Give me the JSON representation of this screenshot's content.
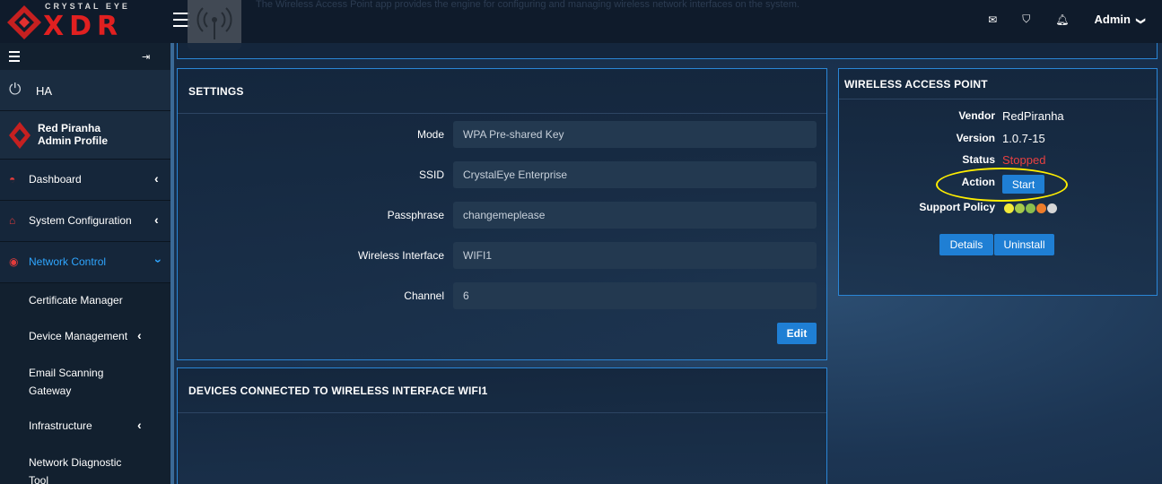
{
  "brand": {
    "top": "CRYSTAL EYE",
    "main": "XDR"
  },
  "app_description": "The Wireless Access Point app provides the engine for configuring and managing wireless network interfaces on the system.",
  "topbar": {
    "mail_icon": "mail-icon",
    "shield_icon": "shield-icon",
    "bell_icon": "bell-icon",
    "admin_label": "Admin",
    "admin_chevron": "❯"
  },
  "sidebar": {
    "ha_label": "HA",
    "profile_name": "Red Piranha",
    "profile_role": "Admin Profile",
    "menu": [
      {
        "label": "Dashboard",
        "icon": "dashboard-icon"
      },
      {
        "label": "System Configuration",
        "icon": "home-icon"
      },
      {
        "label": "Network Control",
        "icon": "network-icon"
      }
    ],
    "submenu": [
      {
        "label": "Certificate Manager"
      },
      {
        "label": "Device Management"
      },
      {
        "label": "Email Scanning Gateway"
      },
      {
        "label": "Infrastructure"
      },
      {
        "label": "Network Diagnostic Tool"
      }
    ]
  },
  "settings": {
    "title": "SETTINGS",
    "fields": [
      {
        "label": "Mode",
        "value": "WPA Pre-shared Key"
      },
      {
        "label": "SSID",
        "value": "CrystalEye Enterprise"
      },
      {
        "label": "Passphrase",
        "value": "changemeplease"
      },
      {
        "label": "Wireless Interface",
        "value": "WIFI1"
      },
      {
        "label": "Channel",
        "value": "6"
      }
    ],
    "edit_label": "Edit"
  },
  "devices": {
    "title": "DEVICES CONNECTED TO WIRELESS INTERFACE WIFI1"
  },
  "wap": {
    "title": "WIRELESS ACCESS POINT",
    "vendor_label": "Vendor",
    "vendor_value": "RedPiranha",
    "version_label": "Version",
    "version_value": "1.0.7-15",
    "status_label": "Status",
    "status_value": "Stopped",
    "action_label": "Action",
    "start_label": "Start",
    "support_label": "Support Policy",
    "support_dots": [
      "#f2e93a",
      "#a6c94a",
      "#8bbd4e",
      "#ee7d2a",
      "#d6d6d6"
    ],
    "details_label": "Details",
    "uninstall_label": "Uninstall"
  },
  "colors": {
    "accent": "#1f7fd4",
    "status_stopped": "#e84040",
    "highlight": "#ffee00",
    "brand_red": "#e02020"
  }
}
